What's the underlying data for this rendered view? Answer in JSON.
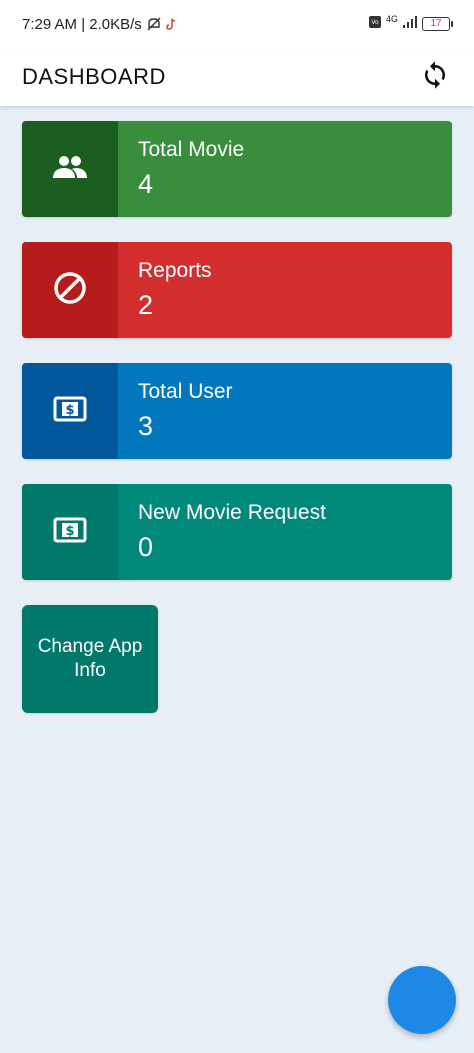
{
  "status_bar": {
    "time_speed": "7:29 AM | 2.0KB/s",
    "network": "4G",
    "battery_level": "17"
  },
  "app_bar": {
    "title": "DASHBOARD",
    "refresh_icon": "refresh-icon"
  },
  "cards": [
    {
      "title": "Total Movie",
      "value": "4",
      "icon": "people-icon",
      "bg": "#388e3c",
      "icon_bg": "#1b5e20"
    },
    {
      "title": "Reports",
      "value": "2",
      "icon": "block-icon",
      "bg": "#d32f2f",
      "icon_bg": "#b71c1c"
    },
    {
      "title": "Total User",
      "value": "3",
      "icon": "money-icon",
      "bg": "#0277bd",
      "icon_bg": "#01579b"
    },
    {
      "title": "New Movie Request",
      "value": "0",
      "icon": "money-icon",
      "bg": "#00897b",
      "icon_bg": "#00796b"
    }
  ],
  "change_app_info": {
    "label": "Change App Info",
    "bg": "#00796b"
  },
  "fab": {
    "color": "#1e88e5"
  }
}
